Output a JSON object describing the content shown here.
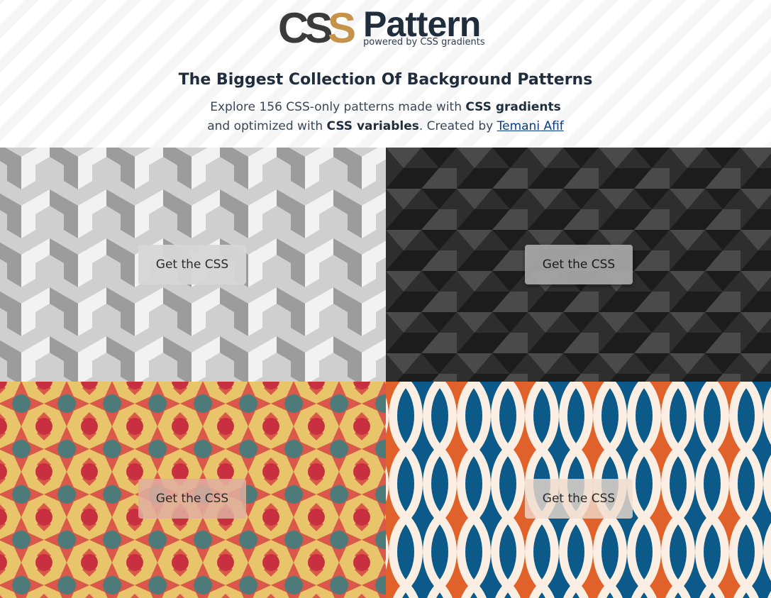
{
  "logo": {
    "mark_text": "CSS",
    "word": "Pattern",
    "tagline": "powered by CSS gradients"
  },
  "headline": "The Biggest Collection Of Background Patterns",
  "intro": {
    "part1": "Explore 156 CSS-only patterns made with ",
    "bold1": "CSS gradients",
    "part2": "and optimized with ",
    "bold2": "CSS variables",
    "part3": ". Created by ",
    "author_link": "Temani Afif"
  },
  "patterns": [
    {
      "button_label": "Get the CSS",
      "colors": {
        "light": "#f2f2f2",
        "mid": "#cfcfcf",
        "dark": "#9c9c9c"
      }
    },
    {
      "button_label": "Get the CSS",
      "colors": {
        "light": "#4a4a4a",
        "mid": "#2e2e2e",
        "dark": "#1c1c1c"
      }
    },
    {
      "button_label": "Get the CSS",
      "colors": {
        "base": "#d9584a",
        "star": "#e8c46a",
        "dot_a": "#4f7a7a",
        "dot_b": "#c9303f"
      }
    },
    {
      "button_label": "Get the CSS",
      "colors": {
        "cream": "#fbeee3",
        "orange": "#e0622a",
        "blue": "#0b5a8a"
      }
    }
  ]
}
